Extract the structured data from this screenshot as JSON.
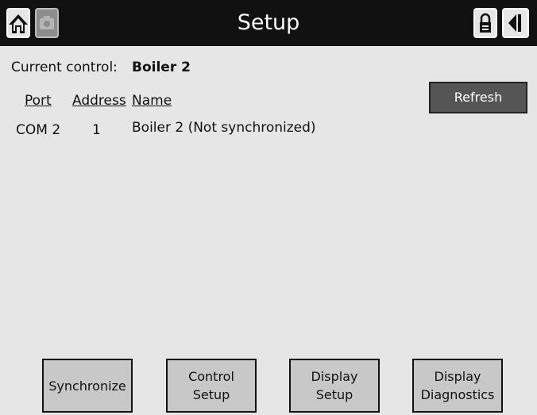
{
  "header": {
    "title": "Setup",
    "icons": [
      "home-icon",
      "camera-icon",
      "lock-icon",
      "back-arrow-icon"
    ]
  },
  "current_control": {
    "label": "Current control:",
    "value": "Boiler 2"
  },
  "table": {
    "headers": {
      "port": "Port",
      "address": "Address",
      "name": "Name"
    },
    "rows": [
      {
        "port": "COM 2",
        "address": "1",
        "name": "Boiler 2 (Not synchronized)"
      }
    ]
  },
  "buttons": {
    "refresh": "Refresh",
    "synchronize": "Synchronize",
    "control_setup": "Control\nSetup",
    "display_setup": "Display\nSetup",
    "display_diagnostics": "Display\nDiagnostics"
  }
}
